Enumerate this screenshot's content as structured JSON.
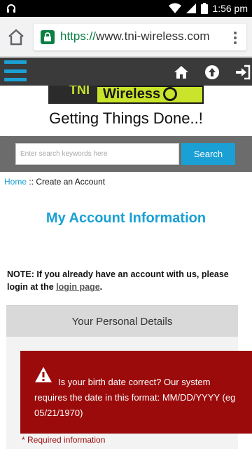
{
  "status": {
    "time": "1:56 pm"
  },
  "browser": {
    "url_scheme": "https://",
    "url_host": "www.tni-wireless.com"
  },
  "logo": {
    "text": "Wireless",
    "partial_text": "TNI"
  },
  "header": {
    "tagline": "Getting Things Done..!"
  },
  "search": {
    "placeholder": "Enter search keywords here",
    "button_label": "Search"
  },
  "breadcrumb": {
    "home": "Home",
    "separator": "::",
    "current": "Create an Account"
  },
  "main": {
    "title": "My Account Information",
    "note_prefix": "NOTE: If you already have an account with us, please login at the ",
    "note_link": "login page",
    "note_suffix": ".",
    "panel_title": "Your Personal Details",
    "required_label": "* Required information"
  },
  "alert": {
    "message": "Is your birth date correct? Our system requires the date in this format: MM/DD/YYYY (eg 05/21/1970)"
  },
  "colors": {
    "accent": "#1aa0d4",
    "navbar": "#3a3a3a",
    "alert": "#9b0b0b",
    "secure": "#0b8043"
  }
}
